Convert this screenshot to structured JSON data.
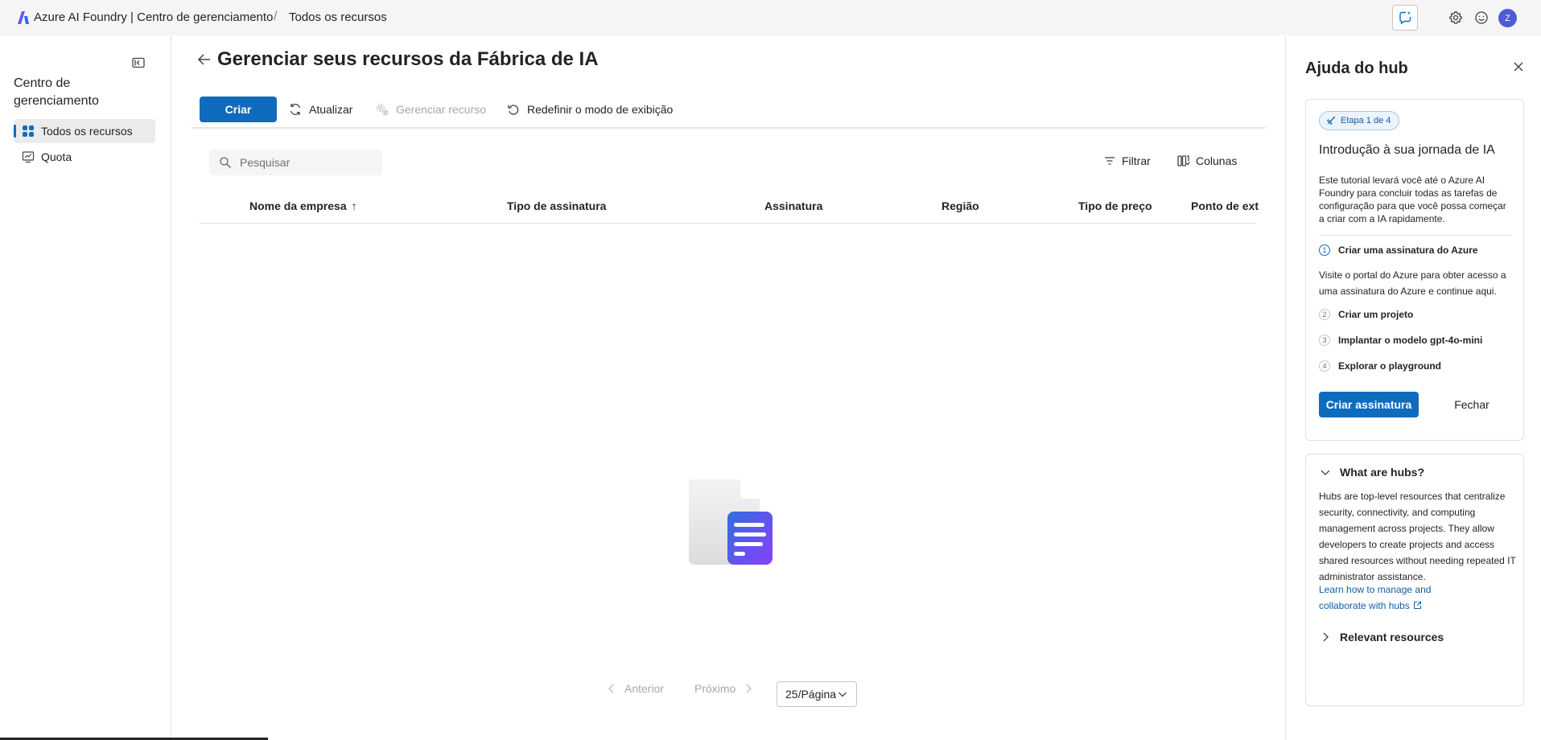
{
  "topbar": {
    "brand": "Azure AI Foundry | Centro de gerenciamento",
    "breadcrumb_separator": "/",
    "breadcrumb_current": "Todos os recursos",
    "avatar_initial": "Z",
    "icons": [
      "azure-ai-logo-icon",
      "chat-feedback-icon",
      "gear-icon",
      "smile-icon"
    ]
  },
  "sidebar": {
    "title": "Centro de gerenciamento",
    "items": [
      {
        "label": "Todos os recursos",
        "icon": "grid-icon",
        "active": true
      },
      {
        "label": "Quota",
        "icon": "gauge-icon",
        "active": false
      }
    ]
  },
  "main": {
    "title": "Gerenciar seus recursos da Fábrica de IA",
    "toolbar": {
      "create": "Criar",
      "refresh": "Atualizar",
      "manage": "Gerenciar recurso",
      "reset": "Redefinir o modo de exibição"
    },
    "search_placeholder": "Pesquisar",
    "filter": "Filtrar",
    "columns_btn": "Colunas",
    "columns": [
      "Nome da empresa",
      "Tipo de assinatura",
      "Assinatura",
      "Região",
      "Tipo de preço",
      "Ponto de ext"
    ],
    "sort_indicator": "↑",
    "pager": {
      "prev": "Anterior",
      "next": "Próximo",
      "per_page": "25/Página"
    }
  },
  "help_panel": {
    "title": "Ajuda do hub",
    "step_badge": "Etapa 1 de 4",
    "heading": "Introdução à sua jornada de IA",
    "intro": "Este tutorial levará você até o Azure AI Foundry para concluir todas as tarefas de configuração para que você possa começar a criar com a IA rapidamente.",
    "steps": [
      {
        "num": "1",
        "label": "Criar uma assinatura do Azure"
      },
      {
        "num": "2",
        "label": "Criar um projeto"
      },
      {
        "num": "3",
        "label": "Implantar o modelo gpt-4o-mini"
      },
      {
        "num": "4",
        "label": "Explorar o playground"
      }
    ],
    "step_desc": "Visite o portal do Azure para obter acesso a uma assinatura do Azure e continue aqui.",
    "primary_btn": "Criar assinatura",
    "close_btn": "Fechar",
    "hubs_heading": "What are hubs?",
    "hubs_body": "Hubs are top-level resources that centralize security, connectivity, and computing management across projects. They allow developers to create projects and access shared resources without needing repeated IT administrator assistance.",
    "hubs_link": "Learn how to manage and collaborate with hubs",
    "relevant_heading": "Relevant resources"
  },
  "colors": {
    "accent": "#0f6cbd",
    "topbar_bg": "#f5f5f5",
    "selected_bg": "#ebebeb",
    "link": "#115ea3"
  }
}
